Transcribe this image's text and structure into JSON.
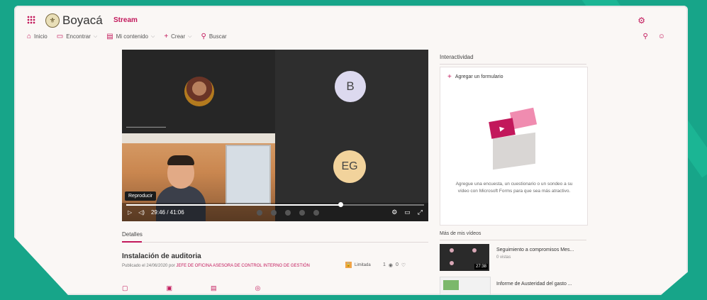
{
  "header": {
    "org_name": "Boyacá",
    "app_name": "Stream"
  },
  "nav": {
    "items": [
      {
        "label": "Inicio",
        "icon": "home-icon"
      },
      {
        "label": "Encontrar",
        "icon": "find-icon"
      },
      {
        "label": "Mi contenido",
        "icon": "content-icon"
      },
      {
        "label": "Crear",
        "icon": "plus-icon"
      },
      {
        "label": "Buscar",
        "icon": "search-icon"
      }
    ]
  },
  "video": {
    "participant_b": "B",
    "participant_eg": "EG",
    "tooltip": "Reproducir",
    "time": "29:46 / 41:06",
    "progress": 0.72
  },
  "details": {
    "tab_label": "Detalles",
    "title": "Instalación de auditoria",
    "published_prefix": "Publicado el 24/06/2020 por",
    "author": "JEFE DE OFICINA ASESORA DE CONTROL INTERNO DE GESTIÓN",
    "visibility": "Limitada",
    "views": "1",
    "likes": "0"
  },
  "interactivity": {
    "title": "Interactividad",
    "add_form": "Agregar un formulario",
    "description": "Agregue una encuesta, un cuestionario o un sondeo a su vídeo con Microsoft Forms para que sea más atractivo."
  },
  "more_videos": {
    "title": "Más de mis vídeos",
    "items": [
      {
        "title": "Seguimiento a compromisos Mes...",
        "subtitle": "0 vistas",
        "duration": "27:38"
      },
      {
        "title": "Informe de Austeridad del gasto ..."
      }
    ]
  },
  "colors": {
    "accent": "#c2185b",
    "background": "#17a589"
  }
}
